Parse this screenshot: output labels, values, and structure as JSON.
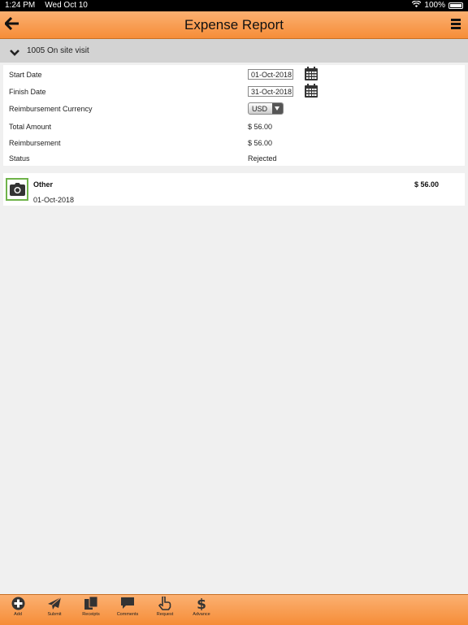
{
  "status_bar": {
    "time": "1:24 PM",
    "date": "Wed Oct 10",
    "battery": "100%"
  },
  "header": {
    "title": "Expense Report"
  },
  "report": {
    "label": "1005 On site visit"
  },
  "details": {
    "start_date": {
      "label": "Start Date",
      "value": "01-Oct-2018"
    },
    "finish_date": {
      "label": "Finish Date",
      "value": "31-Oct-2018"
    },
    "currency": {
      "label": "Reimbursement Currency",
      "value": "USD"
    },
    "total": {
      "label": "Total Amount",
      "value": "$ 56.00"
    },
    "reimbursement": {
      "label": "Reimbursement",
      "value": "$ 56.00"
    },
    "status": {
      "label": "Status",
      "value": "Rejected"
    }
  },
  "expenses": [
    {
      "name": "Other",
      "date": "01-Oct-2018",
      "amount": "$ 56.00"
    }
  ],
  "tabs": [
    {
      "label": "Add",
      "icon": "plus-circle-icon"
    },
    {
      "label": "Submit",
      "icon": "paper-plane-icon"
    },
    {
      "label": "Receipts",
      "icon": "copy-icon"
    },
    {
      "label": "Comments",
      "icon": "comment-icon"
    },
    {
      "label": "Request",
      "icon": "hand-pointer-icon"
    },
    {
      "label": "Advance",
      "icon": "dollar-icon"
    }
  ]
}
